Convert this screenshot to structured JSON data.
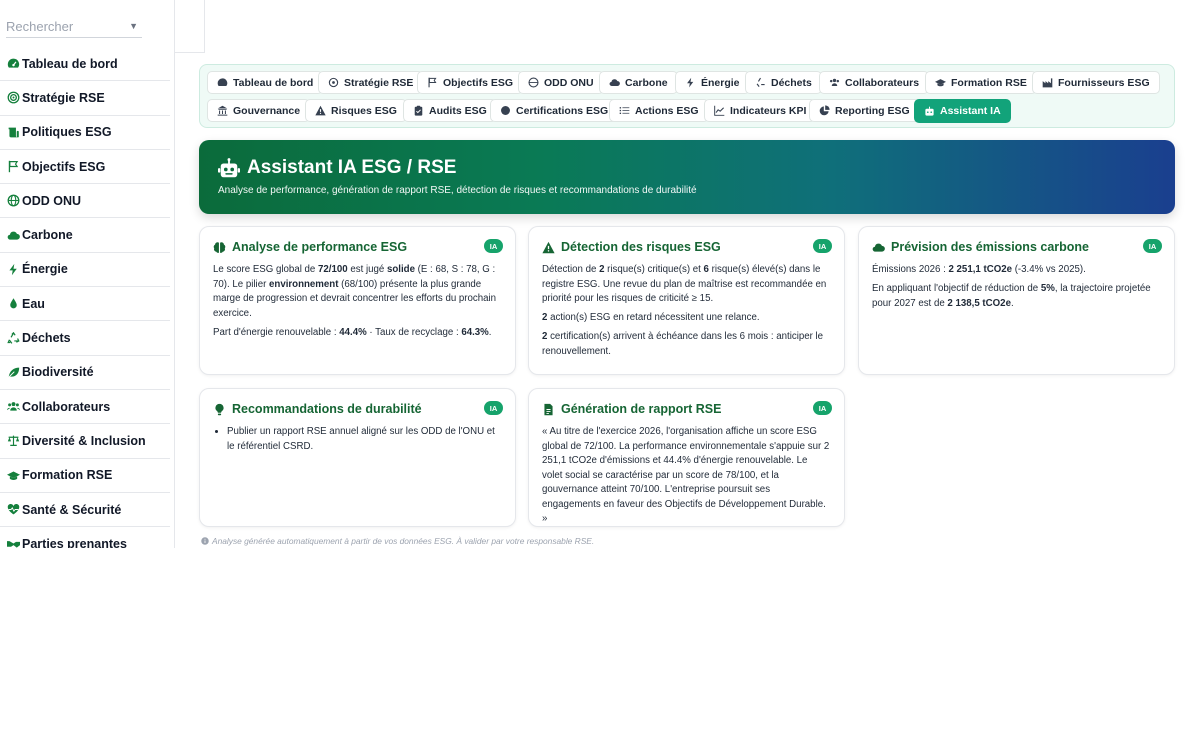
{
  "sidebar": {
    "search_placeholder": "Rechercher",
    "items": [
      {
        "label": "Tableau de bord",
        "icon": "gauge-icon"
      },
      {
        "label": "Stratégie RSE",
        "icon": "target-icon"
      },
      {
        "label": "Politiques ESG",
        "icon": "scroll-icon"
      },
      {
        "label": "Objectifs ESG",
        "icon": "flag-icon"
      },
      {
        "label": "ODD ONU",
        "icon": "globe-icon"
      },
      {
        "label": "Carbone",
        "icon": "cloud-icon"
      },
      {
        "label": "Énergie",
        "icon": "bolt-icon"
      },
      {
        "label": "Eau",
        "icon": "droplet-icon"
      },
      {
        "label": "Déchets",
        "icon": "recycle-icon"
      },
      {
        "label": "Biodiversité",
        "icon": "leaf-icon"
      },
      {
        "label": "Collaborateurs",
        "icon": "users-icon"
      },
      {
        "label": "Diversité & Inclusion",
        "icon": "scale-icon"
      },
      {
        "label": "Formation RSE",
        "icon": "graduation-cap-icon"
      },
      {
        "label": "Santé & Sécurité",
        "icon": "heart-pulse-icon"
      },
      {
        "label": "Parties prenantes",
        "icon": "handshake-icon"
      }
    ]
  },
  "tabs": {
    "row1": [
      {
        "label": "Tableau de bord",
        "icon": "gauge-icon"
      },
      {
        "label": "Stratégie RSE",
        "icon": "target-icon"
      },
      {
        "label": "Objectifs ESG",
        "icon": "flag-icon"
      },
      {
        "label": "ODD ONU",
        "icon": "globe-icon"
      },
      {
        "label": "Carbone",
        "icon": "cloud-icon"
      },
      {
        "label": "Énergie",
        "icon": "bolt-icon"
      },
      {
        "label": "Déchets",
        "icon": "recycle-icon"
      },
      {
        "label": "Collaborateurs",
        "icon": "users-icon"
      },
      {
        "label": "Formation RSE",
        "icon": "graduation-cap-icon"
      },
      {
        "label": "Fournisseurs ESG",
        "icon": "industry-icon"
      }
    ],
    "row2": [
      {
        "label": "Gouvernance",
        "icon": "landmark-icon"
      },
      {
        "label": "Risques ESG",
        "icon": "warning-icon"
      },
      {
        "label": "Audits ESG",
        "icon": "clipboard-check-icon"
      },
      {
        "label": "Certifications ESG",
        "icon": "certificate-icon"
      },
      {
        "label": "Actions ESG",
        "icon": "list-icon"
      },
      {
        "label": "Indicateurs KPI",
        "icon": "chart-line-icon"
      },
      {
        "label": "Reporting ESG",
        "icon": "chart-pie-icon"
      },
      {
        "label": "Assistant IA",
        "icon": "robot-icon",
        "active": true
      }
    ]
  },
  "banner": {
    "title": "Assistant IA ESG / RSE",
    "subtitle": "Analyse de performance, génération de rapport RSE, détection de risques et recommandations de durabilité"
  },
  "cards": {
    "badge": "IA",
    "performance": {
      "title": "Analyse de performance ESG",
      "p1": {
        "a": "Le score ESG global de ",
        "score": "72/100",
        "b": " est jugé ",
        "grade": "solide",
        "c": " (E : 68, S : 78, G : 70). Le pilier ",
        "pillar": "environnement",
        "d": " (68/100) présente la plus grande marge de progression et devrait concentrer les efforts du prochain exercice."
      },
      "p2": {
        "a": "Part d'énergie renouvelable : ",
        "renewable": "44.4%",
        "b": " · Taux de recyclage : ",
        "recycling": "64.3%",
        "c": "."
      }
    },
    "risks": {
      "title": "Détection des risques ESG",
      "p1": {
        "a": "Détection de ",
        "critical": "2",
        "b": " risque(s) critique(s) et ",
        "high": "6",
        "c": " risque(s) élevé(s) dans le registre ESG. Une revue du plan de maîtrise est recommandée en priorité pour les risques de criticité ≥ 15."
      },
      "p2": {
        "late": "2",
        "a": " action(s) ESG en retard nécessitent une relance."
      },
      "p3": {
        "certs": "2",
        "a": " certification(s) arrivent à échéance dans les 6 mois : anticiper le renouvellement."
      }
    },
    "emissions": {
      "title": "Prévision des émissions carbone",
      "p1": {
        "a": "Émissions 2026 : ",
        "value": "2 251,1 tCO2e",
        "b": " (-3.4% vs 2025)."
      },
      "p2": {
        "a": "En appliquant l'objectif de réduction de ",
        "rate": "5%",
        "b": ", la trajectoire projetée pour 2027 est de ",
        "projection": "2 138,5 tCO2e",
        "c": "."
      }
    },
    "recommendations": {
      "title": "Recommandations de durabilité",
      "items": [
        "Publier un rapport RSE annuel aligné sur les ODD de l'ONU et le référentiel CSRD."
      ]
    },
    "report": {
      "title": "Génération de rapport RSE",
      "text": "« Au titre de l'exercice 2026, l'organisation affiche un score ESG global de 72/100. La performance environnementale s'appuie sur 2 251,1 tCO2e d'émissions et 44.4% d'énergie renouvelable. Le volet social se caractérise par un score de 78/100, et la gouvernance atteint 70/100. L'entreprise poursuit ses engagements en faveur des Objectifs de Développement Durable. »"
    }
  },
  "footnote": "Analyse générée automatiquement à partir de vos données ESG. À valider par votre responsable RSE.",
  "colors": {
    "primary": "#12a37a",
    "title_green": "#166534",
    "banner_start": "#0b6b3b",
    "banner_end": "#1a3f8f"
  }
}
